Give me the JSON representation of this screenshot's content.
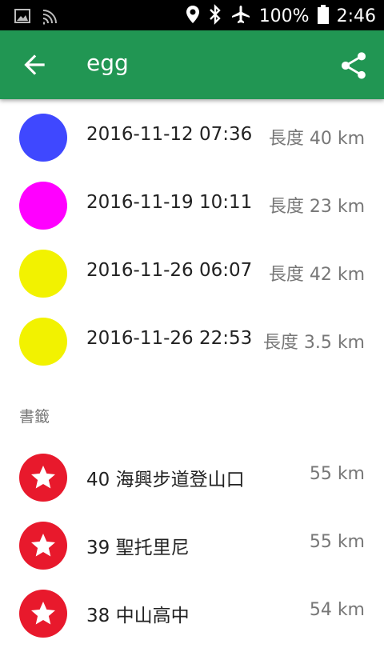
{
  "status": {
    "battery": "100%",
    "time": "2:46"
  },
  "toolbar": {
    "title": "egg"
  },
  "routes": [
    {
      "datetime": "2016-11-12 07:36",
      "length": "長度 40 km",
      "color": "#3f48ff"
    },
    {
      "datetime": "2016-11-19 10:11",
      "length": "長度 23 km",
      "color": "#ff00ff"
    },
    {
      "datetime": "2016-11-26 06:07",
      "length": "長度 42 km",
      "color": "#f2f200"
    },
    {
      "datetime": "2016-11-26 22:53",
      "length": "長度 3.5 km",
      "color": "#f2f200"
    }
  ],
  "bookmarks_header": "書籤",
  "bookmarks": [
    {
      "name": "40 海興步道登山口",
      "distance": "55 km"
    },
    {
      "name": "39 聖托里尼",
      "distance": "55 km"
    },
    {
      "name": "38 中山高中",
      "distance": "54 km"
    }
  ],
  "colors": {
    "app_bar": "#219653",
    "bookmark": "#e8192c"
  }
}
